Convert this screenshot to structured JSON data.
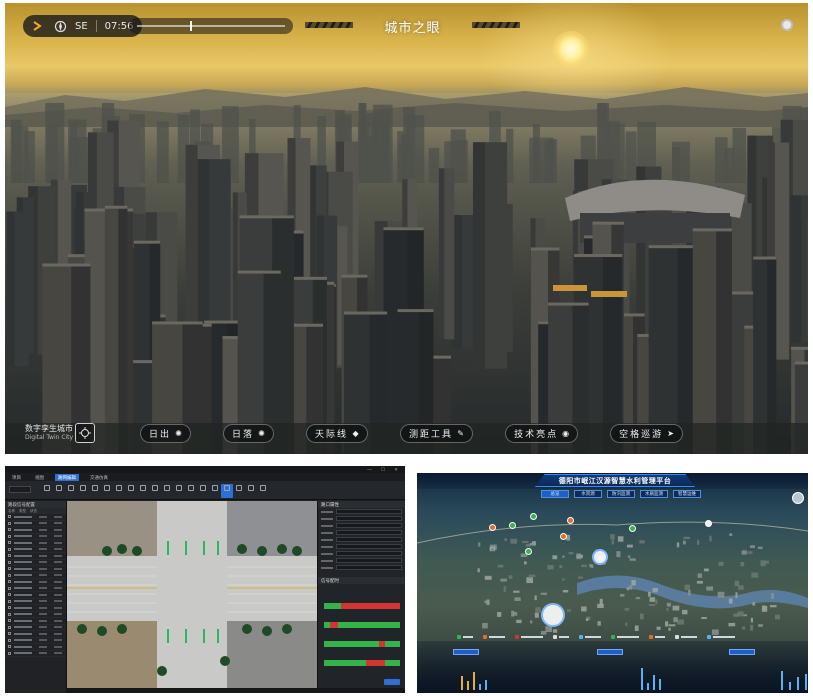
{
  "city_view": {
    "compass_heading": "SE",
    "time": "07:56",
    "time_progress": 0.36,
    "title": "城市之眼",
    "brand_main": "数字孪生城市",
    "brand_sub": "Digital Twin City",
    "modes": [
      {
        "label": "日出",
        "icon": "sunrise-icon",
        "glyph": "✺"
      },
      {
        "label": "日落",
        "icon": "sunset-icon",
        "glyph": "✺"
      },
      {
        "label": "天际线",
        "icon": "skyline-icon",
        "glyph": "◆"
      },
      {
        "label": "测距工具",
        "icon": "ruler-icon",
        "glyph": "✎"
      },
      {
        "label": "技术亮点",
        "icon": "highlight-icon",
        "glyph": "◉"
      },
      {
        "label": "空格巡游",
        "icon": "tour-icon",
        "glyph": "➤"
      }
    ],
    "colors": {
      "sky_top": "#b8922f",
      "sun": "#fff3b0",
      "hud_bg": "#141618"
    }
  },
  "traffic_editor": {
    "menu_tabs": [
      "项目",
      "视图",
      "路网编辑",
      "交通仿真"
    ],
    "active_tab": "路网编辑",
    "left_panel_title": "路段信号配置",
    "left_columns": [
      "名称",
      "类型",
      "状态"
    ],
    "left_rows": 22,
    "right_sections": [
      "路口属性",
      "信号配时"
    ],
    "signal_rows": 4,
    "accent": "#2d6fd6"
  },
  "water_platform": {
    "title": "德阳市岷江汉源智慧水利管理平台",
    "tabs": [
      "总览",
      "水资源",
      "防汛监测",
      "水质监测",
      "智慧运维"
    ],
    "active_tab": "总览",
    "accent": "#1f5fc8"
  }
}
